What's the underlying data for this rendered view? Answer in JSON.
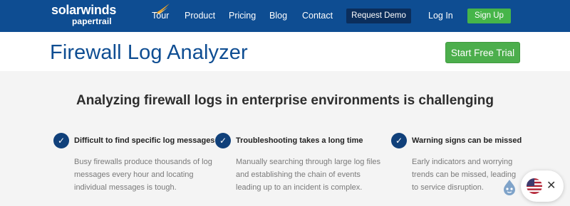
{
  "nav": {
    "logo_main": "solarwinds",
    "logo_sub": "papertrail",
    "links": [
      "Tour",
      "Product",
      "Pricing",
      "Blog",
      "Contact"
    ],
    "request_demo": "Request Demo",
    "login": "Log In",
    "signup": "Sign Up"
  },
  "header": {
    "title": "Firewall Log Analyzer",
    "cta": "Start Free Trial"
  },
  "main": {
    "headline": "Analyzing firewall logs in enterprise environments is challenging",
    "features": [
      {
        "title": "Difficult to find specific log messages",
        "body": "Busy firewalls produce thousands of log messages every hour and locating individual messages is tough.",
        "icon": "check-icon"
      },
      {
        "title": "Troubleshooting takes a long time",
        "body": "Manually searching through large log files and establishing the chain of events leading up to an incident is complex.",
        "icon": "check-icon"
      },
      {
        "title": "Warning signs can be missed",
        "body": "Early indicators and worrying trends can be missed, leading to service disruption.",
        "icon": "check-icon"
      }
    ]
  },
  "widgets": {
    "language_flag": "us-flag-icon",
    "close_symbol": "✕"
  },
  "colors": {
    "brand_blue": "#0e4d92",
    "dark_navy": "#0b2e5c",
    "cta_green": "#4cae4c",
    "accent_orange": "#f5a623"
  }
}
